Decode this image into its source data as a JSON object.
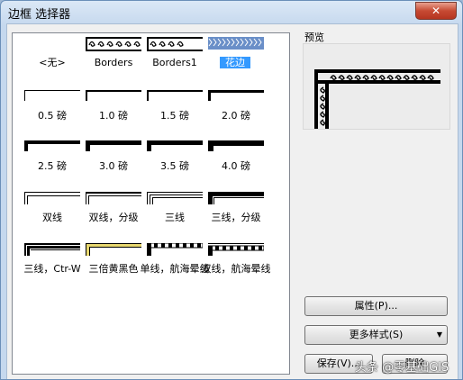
{
  "window": {
    "title": "边框 选择器",
    "close_glyph": "✕"
  },
  "borders": [
    {
      "label": "<无>",
      "style": "none"
    },
    {
      "label": "Borders",
      "style": "ornate"
    },
    {
      "label": "Borders1",
      "style": "ornate2"
    },
    {
      "label": "花边",
      "style": "pattern",
      "selected": true
    },
    {
      "label": "0.5 磅",
      "style": "line",
      "weight": 0.5
    },
    {
      "label": "1.0 磅",
      "style": "line",
      "weight": 1.0
    },
    {
      "label": "1.5 磅",
      "style": "line",
      "weight": 1.5
    },
    {
      "label": "2.0 磅",
      "style": "line",
      "weight": 2.0
    },
    {
      "label": "2.5 磅",
      "style": "line",
      "weight": 2.5
    },
    {
      "label": "3.0 磅",
      "style": "line",
      "weight": 3.0
    },
    {
      "label": "3.5 磅",
      "style": "line",
      "weight": 3.5
    },
    {
      "label": "4.0 磅",
      "style": "line",
      "weight": 4.0
    },
    {
      "label": "双线",
      "style": "double"
    },
    {
      "label": "双线，分级",
      "style": "double-graded"
    },
    {
      "label": "三线",
      "style": "triple"
    },
    {
      "label": "三线，分级",
      "style": "triple-graded"
    },
    {
      "label": "三线，Ctr-W",
      "style": "triple-ctrw"
    },
    {
      "label": "三倍黄黑色",
      "style": "triple-yellow-black"
    },
    {
      "label": "单线，航海晕线",
      "style": "nautical-single"
    },
    {
      "label": "双线，航海晕线",
      "style": "nautical-double"
    }
  ],
  "preview": {
    "label": "预览"
  },
  "buttons": {
    "properties": "属性(P)...",
    "more_styles": "更多样式(S)",
    "save": "保存(V)...",
    "delete": "删除"
  },
  "watermark": "头条 @零基础GIS",
  "colors": {
    "selection": "#3399ff",
    "border_line": "#000000",
    "yellow": "#e8d870",
    "pattern_blue": "#6a8fc8"
  }
}
